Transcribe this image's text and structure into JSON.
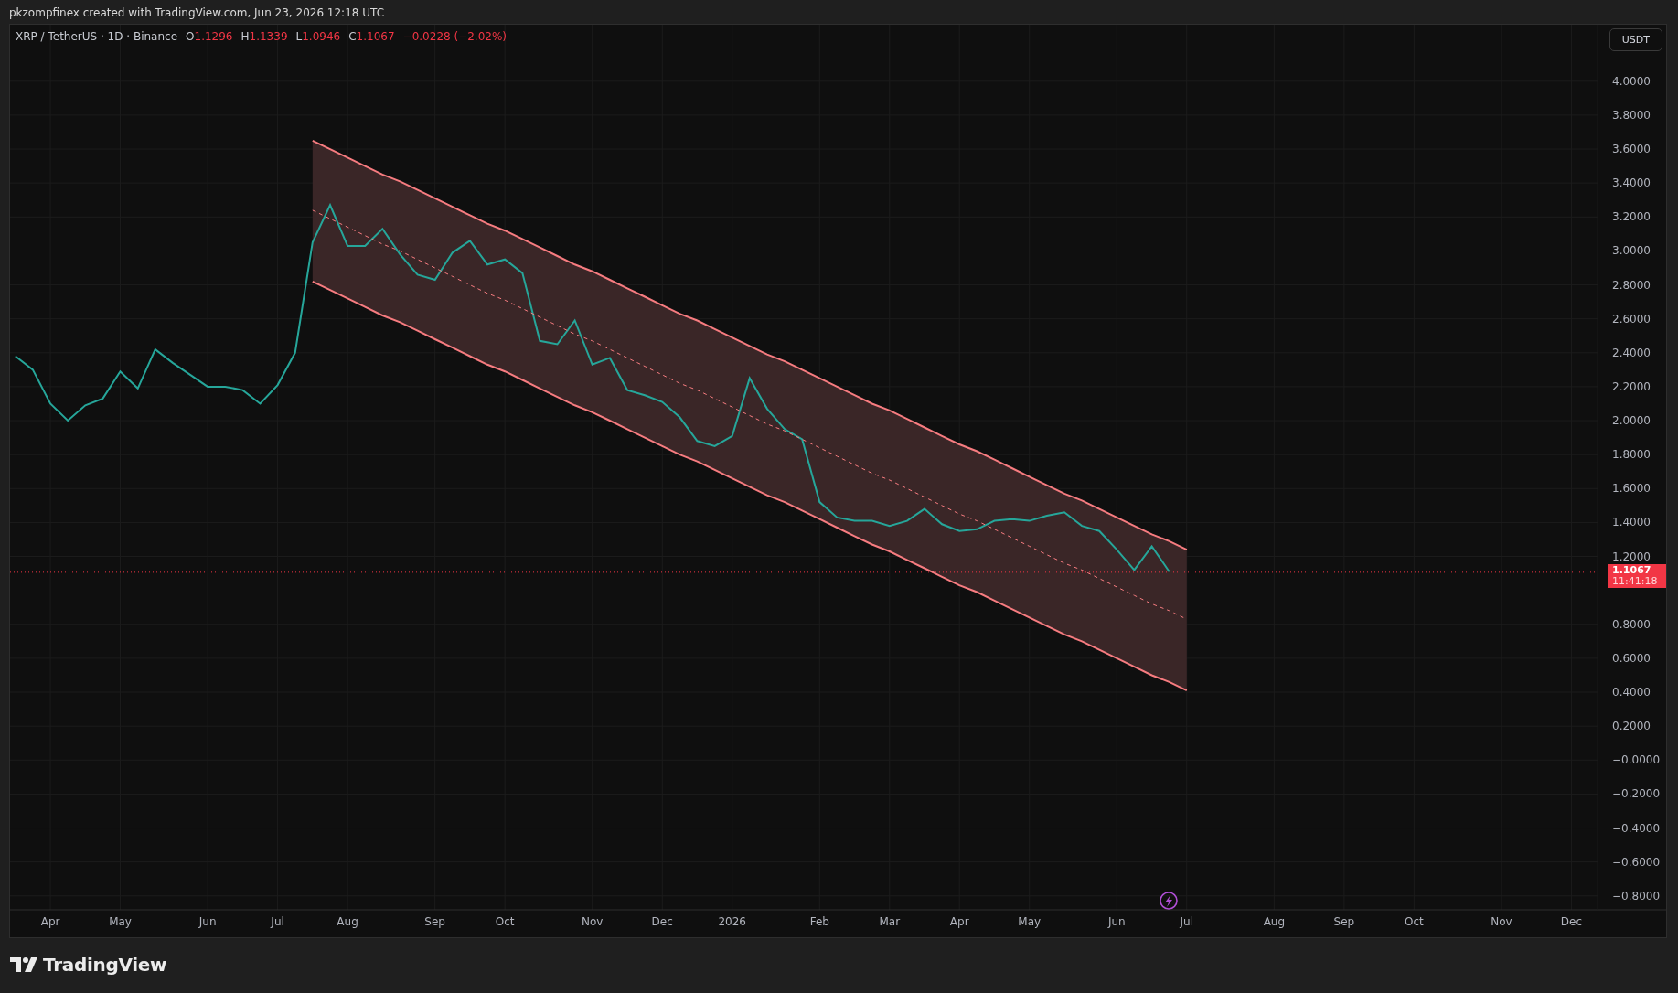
{
  "header": {
    "text": "pkzompfinex created with TradingView.com, Jun 23, 2026 12:18 UTC"
  },
  "chart": {
    "legend": {
      "symbol": "XRP / TetherUS · 1D · Binance",
      "ohlc": [
        {
          "label": "O",
          "value": "1.1296"
        },
        {
          "label": "H",
          "value": "1.1339"
        },
        {
          "label": "L",
          "value": "1.0946"
        },
        {
          "label": "C",
          "value": "1.1067"
        }
      ],
      "change": "−0.0228 (−2.02%)"
    },
    "currency_button": "USDT",
    "price_label": {
      "price": "1.1067",
      "countdown": "11:41:18"
    },
    "chart_data": {
      "type": "line",
      "grid": true,
      "categories": [
        null,
        null,
        "Apr",
        null,
        null,
        null,
        "May",
        null,
        null,
        null,
        null,
        "Jun",
        null,
        null,
        null,
        "Jul",
        null,
        null,
        null,
        "Aug",
        null,
        null,
        null,
        null,
        "Sep",
        null,
        null,
        null,
        "Oct",
        null,
        null,
        null,
        null,
        "Nov",
        null,
        null,
        null,
        "Dec",
        null,
        null,
        null,
        "2026",
        null,
        null,
        null,
        null,
        "Feb",
        null,
        null,
        null,
        "Mar",
        null,
        null,
        null,
        "Apr",
        null,
        null,
        null,
        "May",
        null,
        null,
        null,
        null,
        "Jun",
        null,
        null,
        null,
        "Jul",
        null,
        null,
        null,
        null,
        "Aug",
        null,
        null,
        null,
        "Sep",
        null,
        null,
        null,
        "Oct",
        null,
        null,
        null,
        null,
        "Nov",
        null,
        null,
        null,
        "Dec",
        null
      ],
      "series": [
        {
          "color": "#26a69a",
          "line_style": "solid",
          "values": [
            2.38,
            2.3,
            2.1,
            2.0,
            2.09,
            2.13,
            2.29,
            2.19,
            2.42,
            2.34,
            2.27,
            2.2,
            2.2,
            2.18,
            2.1,
            2.21,
            2.4,
            3.05,
            3.27,
            3.03,
            3.03,
            3.13,
            2.98,
            2.86,
            2.83,
            2.99,
            3.06,
            2.92,
            2.95,
            2.87,
            2.47,
            2.45,
            2.59,
            2.33,
            2.37,
            2.18,
            2.15,
            2.11,
            2.02,
            1.88,
            1.85,
            1.91,
            2.25,
            2.07,
            1.95,
            1.89,
            1.52,
            1.43,
            1.41,
            1.41,
            1.38,
            1.41,
            1.48,
            1.39,
            1.35,
            1.36,
            1.41,
            1.42,
            1.41,
            1.44,
            1.46,
            1.38,
            1.35,
            1.24,
            1.12,
            1.26,
            1.11,
            null,
            null,
            null,
            null,
            null,
            null,
            null,
            null,
            null,
            null,
            null,
            null,
            null,
            null,
            null,
            null,
            null,
            null,
            null,
            null,
            null,
            null,
            null,
            null
          ]
        },
        {
          "color": "#f77c80",
          "line_style": "solid",
          "values": [
            null,
            null,
            null,
            null,
            null,
            null,
            null,
            null,
            null,
            null,
            null,
            null,
            null,
            null,
            null,
            null,
            null,
            3.65,
            3.6,
            3.55,
            3.5,
            3.45,
            3.41,
            3.36,
            3.31,
            3.26,
            3.21,
            3.16,
            3.12,
            3.07,
            3.02,
            2.97,
            2.92,
            2.88,
            2.83,
            2.78,
            2.73,
            2.68,
            2.63,
            2.59,
            2.54,
            2.49,
            2.44,
            2.39,
            2.35,
            2.3,
            2.25,
            2.2,
            2.15,
            2.1,
            2.06,
            2.01,
            1.96,
            1.91,
            1.86,
            1.82,
            1.77,
            1.72,
            1.67,
            1.62,
            1.57,
            1.53,
            1.48,
            1.43,
            1.38,
            1.33,
            1.29,
            1.24,
            null,
            null,
            null,
            null,
            null,
            null,
            null,
            null,
            null,
            null,
            null,
            null,
            null,
            null,
            null,
            null,
            null,
            null,
            null,
            null,
            null,
            null,
            null
          ]
        },
        {
          "color": "#f77c80",
          "line_style": "dashed",
          "values": [
            null,
            null,
            null,
            null,
            null,
            null,
            null,
            null,
            null,
            null,
            null,
            null,
            null,
            null,
            null,
            null,
            null,
            3.24,
            3.19,
            3.14,
            3.09,
            3.04,
            3.0,
            2.95,
            2.9,
            2.85,
            2.8,
            2.75,
            2.71,
            2.66,
            2.61,
            2.56,
            2.51,
            2.47,
            2.42,
            2.37,
            2.32,
            2.27,
            2.22,
            2.18,
            2.13,
            2.08,
            2.03,
            1.98,
            1.94,
            1.89,
            1.84,
            1.79,
            1.74,
            1.69,
            1.65,
            1.6,
            1.55,
            1.5,
            1.45,
            1.41,
            1.36,
            1.31,
            1.26,
            1.21,
            1.16,
            1.12,
            1.07,
            1.02,
            0.97,
            0.92,
            0.88,
            0.83,
            null,
            null,
            null,
            null,
            null,
            null,
            null,
            null,
            null,
            null,
            null,
            null,
            null,
            null,
            null,
            null,
            null,
            null,
            null,
            null,
            null,
            null,
            null
          ]
        },
        {
          "color": "#f77c80",
          "line_style": "solid",
          "values": [
            null,
            null,
            null,
            null,
            null,
            null,
            null,
            null,
            null,
            null,
            null,
            null,
            null,
            null,
            null,
            null,
            null,
            2.82,
            2.77,
            2.72,
            2.67,
            2.62,
            2.58,
            2.53,
            2.48,
            2.43,
            2.38,
            2.33,
            2.29,
            2.24,
            2.19,
            2.14,
            2.09,
            2.05,
            2.0,
            1.95,
            1.9,
            1.85,
            1.8,
            1.76,
            1.71,
            1.66,
            1.61,
            1.56,
            1.52,
            1.47,
            1.42,
            1.37,
            1.32,
            1.27,
            1.23,
            1.18,
            1.13,
            1.08,
            1.03,
            0.99,
            0.94,
            0.89,
            0.84,
            0.79,
            0.74,
            0.7,
            0.65,
            0.6,
            0.55,
            0.5,
            0.46,
            0.41,
            null,
            null,
            null,
            null,
            null,
            null,
            null,
            null,
            null,
            null,
            null,
            null,
            null,
            null,
            null,
            null,
            null,
            null,
            null,
            null,
            null,
            null,
            null
          ]
        }
      ],
      "ylim": [
        -0.882,
        4.333
      ],
      "yticks": [
        {
          "value": 4,
          "label": "4.0000"
        },
        {
          "value": 3.8,
          "label": "3.8000"
        },
        {
          "value": 3.6,
          "label": "3.6000"
        },
        {
          "value": 3.4,
          "label": "3.4000"
        },
        {
          "value": 3.2,
          "label": "3.2000"
        },
        {
          "value": 3,
          "label": "3.0000"
        },
        {
          "value": 2.8,
          "label": "2.8000"
        },
        {
          "value": 2.6,
          "label": "2.6000"
        },
        {
          "value": 2.4,
          "label": "2.4000"
        },
        {
          "value": 2.2,
          "label": "2.2000"
        },
        {
          "value": 2,
          "label": "2.0000"
        },
        {
          "value": 1.8,
          "label": "1.8000"
        },
        {
          "value": 1.6,
          "label": "1.6000"
        },
        {
          "value": 1.4,
          "label": "1.4000"
        },
        {
          "value": 1.2,
          "label": "1.2000"
        },
        {
          "value": 0.8,
          "label": "0.8000"
        },
        {
          "value": 0.6,
          "label": "0.6000"
        },
        {
          "value": 0.4,
          "label": "0.4000"
        },
        {
          "value": 0.2,
          "label": "0.2000"
        },
        {
          "value": 0,
          "label": "−0.0000"
        },
        {
          "value": -0.2,
          "label": "−0.2000"
        },
        {
          "value": -0.4,
          "label": "−0.4000"
        },
        {
          "value": -0.6,
          "label": "−0.6000"
        },
        {
          "value": -0.8,
          "label": "−0.8000"
        }
      ],
      "ref_lines": [
        {
          "axis": "y",
          "value": 1.1067
        }
      ]
    }
  },
  "footer": {
    "logo_text": "TradingView"
  }
}
